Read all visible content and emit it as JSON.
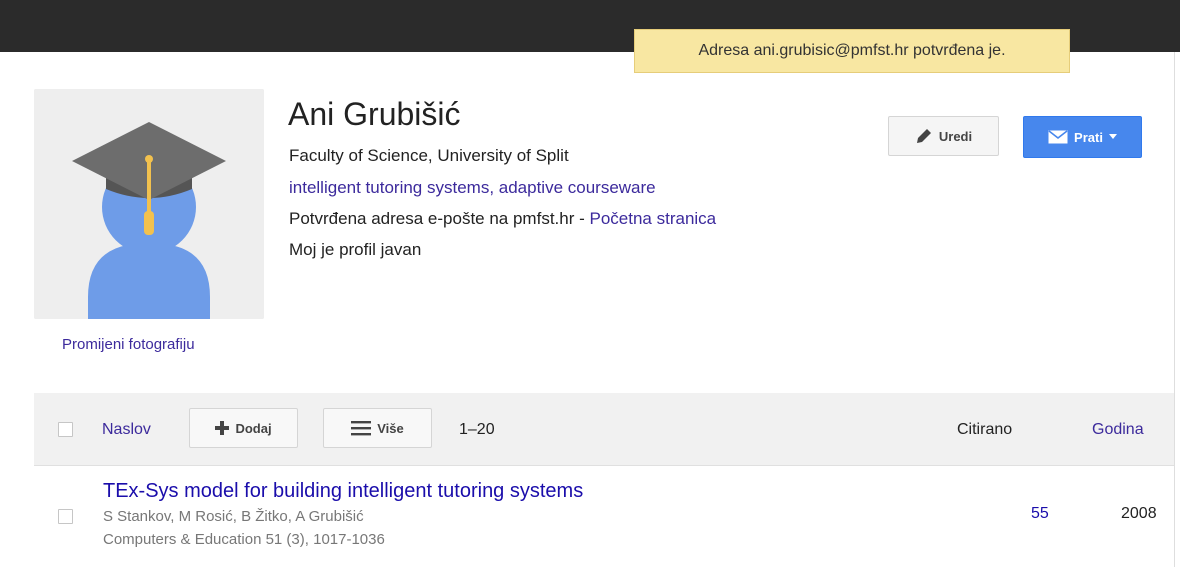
{
  "notification": {
    "message": "Adresa ani.grubisic@pmfst.hr potvrđena je."
  },
  "profile": {
    "name": "Ani Grubišić",
    "affiliation": "Faculty of Science, University of Split",
    "interests": "intelligent tutoring systems, adaptive courseware",
    "email_verified_text": "Potvrđena adresa e-pošte na pmfst.hr - ",
    "homepage_link": "Početna stranica",
    "visibility": "Moj je profil javan",
    "change_photo": "Promijeni fotografiju",
    "avatar_icon": "graduation-cap-avatar-icon"
  },
  "actions": {
    "edit_label": "Uredi",
    "edit_icon": "pencil-icon",
    "follow_label": "Prati",
    "follow_icon": "envelope-icon"
  },
  "toolbar": {
    "title_column": "Naslov",
    "add_label": "Dodaj",
    "more_label": "Više",
    "range": "1–20",
    "cited_column": "Citirano",
    "year_column": "Godina"
  },
  "articles": [
    {
      "title": "TEx-Sys model for building intelligent tutoring systems",
      "authors": "S Stankov, M Rosić, B Žitko, A Grubišić",
      "source": "Computers & Education 51 (3), 1017-1036",
      "cited": "55",
      "year": "2008"
    }
  ],
  "colors": {
    "topbar": "#2b2b2b",
    "toast_bg": "#f8e7a2",
    "follow_button": "#4787ed",
    "link": "#3c2a9c",
    "title_link": "#1a0dab"
  }
}
